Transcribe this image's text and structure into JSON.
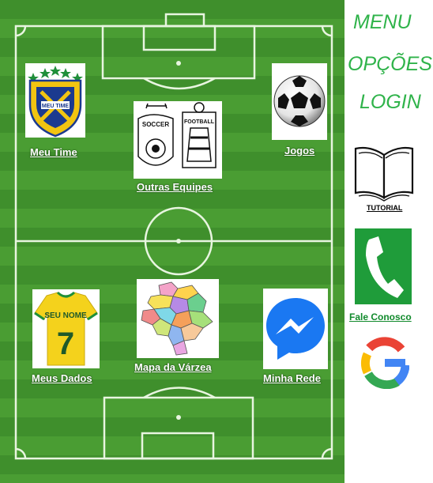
{
  "menu": {
    "menu_label": "MENU",
    "options_label": "OPÇÕES",
    "login_label": "LOGIN"
  },
  "tiles": {
    "meu_time": {
      "label": "Meu Time",
      "crest_text": "MEU TIME"
    },
    "outras_equipes": {
      "label": "Outras Equipes",
      "left_text": "SOCCER",
      "right_text": "FOOTBALL"
    },
    "jogos": {
      "label": "Jogos"
    },
    "meus_dados": {
      "label": "Meus Dados",
      "shirt_text": "SEU NOME",
      "shirt_number": "7"
    },
    "mapa_varzea": {
      "label": "Mapa da Várzea"
    },
    "minha_rede": {
      "label": "Minha Rede"
    }
  },
  "sidebar": {
    "tutorial_label": "TUTORIAL",
    "contact_label": "Fale Conosco"
  },
  "colors": {
    "field_green": "#3f8f2c",
    "menu_green": "#2fb34a",
    "contact_green": "#118a2c",
    "messenger_blue": "#1a78f2"
  }
}
